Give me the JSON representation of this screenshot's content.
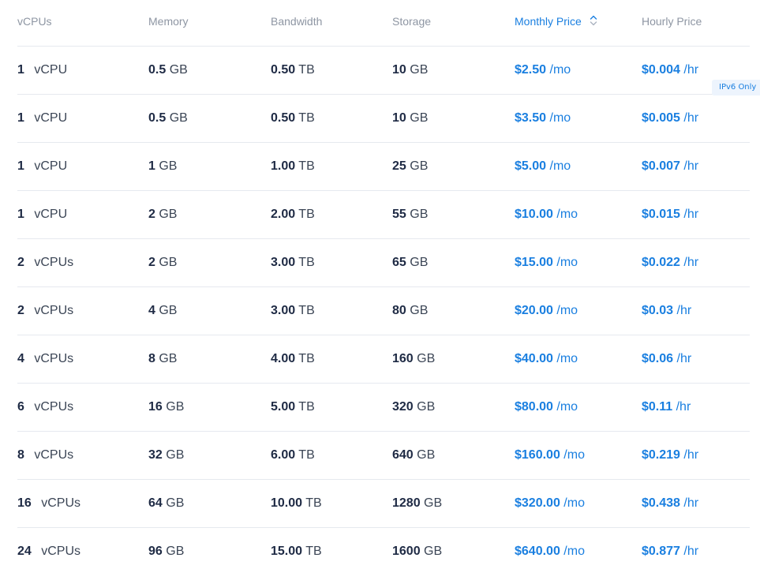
{
  "headers": {
    "vcpus": "vCPUs",
    "memory": "Memory",
    "bandwidth": "Bandwidth",
    "storage": "Storage",
    "monthly_price": "Monthly Price",
    "hourly_price": "Hourly Price",
    "sort_icon": "sort-up-down-icon"
  },
  "badge": "IPv6 Only",
  "colors": {
    "accent": "#1a7fe0",
    "header_text": "#8e96a3",
    "text": "#1e2a44",
    "divider": "#e6e9ef",
    "badge_bg": "#edf4fd"
  },
  "rows": [
    {
      "cpu": "1",
      "cpu_unit": "vCPU",
      "mem": "0.5",
      "mem_unit": "GB",
      "bw": "0.50",
      "bw_unit": "TB",
      "storage": "10",
      "storage_unit": "GB",
      "monthly": "$2.50",
      "monthly_unit": "/mo",
      "hourly": "$0.004",
      "hourly_unit": "/hr"
    },
    {
      "cpu": "1",
      "cpu_unit": "vCPU",
      "mem": "0.5",
      "mem_unit": "GB",
      "bw": "0.50",
      "bw_unit": "TB",
      "storage": "10",
      "storage_unit": "GB",
      "monthly": "$3.50",
      "monthly_unit": "/mo",
      "hourly": "$0.005",
      "hourly_unit": "/hr"
    },
    {
      "cpu": "1",
      "cpu_unit": "vCPU",
      "mem": "1",
      "mem_unit": "GB",
      "bw": "1.00",
      "bw_unit": "TB",
      "storage": "25",
      "storage_unit": "GB",
      "monthly": "$5.00",
      "monthly_unit": "/mo",
      "hourly": "$0.007",
      "hourly_unit": "/hr"
    },
    {
      "cpu": "1",
      "cpu_unit": "vCPU",
      "mem": "2",
      "mem_unit": "GB",
      "bw": "2.00",
      "bw_unit": "TB",
      "storage": "55",
      "storage_unit": "GB",
      "monthly": "$10.00",
      "monthly_unit": "/mo",
      "hourly": "$0.015",
      "hourly_unit": "/hr"
    },
    {
      "cpu": "2",
      "cpu_unit": "vCPUs",
      "mem": "2",
      "mem_unit": "GB",
      "bw": "3.00",
      "bw_unit": "TB",
      "storage": "65",
      "storage_unit": "GB",
      "monthly": "$15.00",
      "monthly_unit": "/mo",
      "hourly": "$0.022",
      "hourly_unit": "/hr"
    },
    {
      "cpu": "2",
      "cpu_unit": "vCPUs",
      "mem": "4",
      "mem_unit": "GB",
      "bw": "3.00",
      "bw_unit": "TB",
      "storage": "80",
      "storage_unit": "GB",
      "monthly": "$20.00",
      "monthly_unit": "/mo",
      "hourly": "$0.03",
      "hourly_unit": "/hr"
    },
    {
      "cpu": "4",
      "cpu_unit": "vCPUs",
      "mem": "8",
      "mem_unit": "GB",
      "bw": "4.00",
      "bw_unit": "TB",
      "storage": "160",
      "storage_unit": "GB",
      "monthly": "$40.00",
      "monthly_unit": "/mo",
      "hourly": "$0.06",
      "hourly_unit": "/hr"
    },
    {
      "cpu": "6",
      "cpu_unit": "vCPUs",
      "mem": "16",
      "mem_unit": "GB",
      "bw": "5.00",
      "bw_unit": "TB",
      "storage": "320",
      "storage_unit": "GB",
      "monthly": "$80.00",
      "monthly_unit": "/mo",
      "hourly": "$0.11",
      "hourly_unit": "/hr"
    },
    {
      "cpu": "8",
      "cpu_unit": "vCPUs",
      "mem": "32",
      "mem_unit": "GB",
      "bw": "6.00",
      "bw_unit": "TB",
      "storage": "640",
      "storage_unit": "GB",
      "monthly": "$160.00",
      "monthly_unit": "/mo",
      "hourly": "$0.219",
      "hourly_unit": "/hr"
    },
    {
      "cpu": "16",
      "cpu_unit": "vCPUs",
      "mem": "64",
      "mem_unit": "GB",
      "bw": "10.00",
      "bw_unit": "TB",
      "storage": "1280",
      "storage_unit": "GB",
      "monthly": "$320.00",
      "monthly_unit": "/mo",
      "hourly": "$0.438",
      "hourly_unit": "/hr"
    },
    {
      "cpu": "24",
      "cpu_unit": "vCPUs",
      "mem": "96",
      "mem_unit": "GB",
      "bw": "15.00",
      "bw_unit": "TB",
      "storage": "1600",
      "storage_unit": "GB",
      "monthly": "$640.00",
      "monthly_unit": "/mo",
      "hourly": "$0.877",
      "hourly_unit": "/hr"
    }
  ]
}
